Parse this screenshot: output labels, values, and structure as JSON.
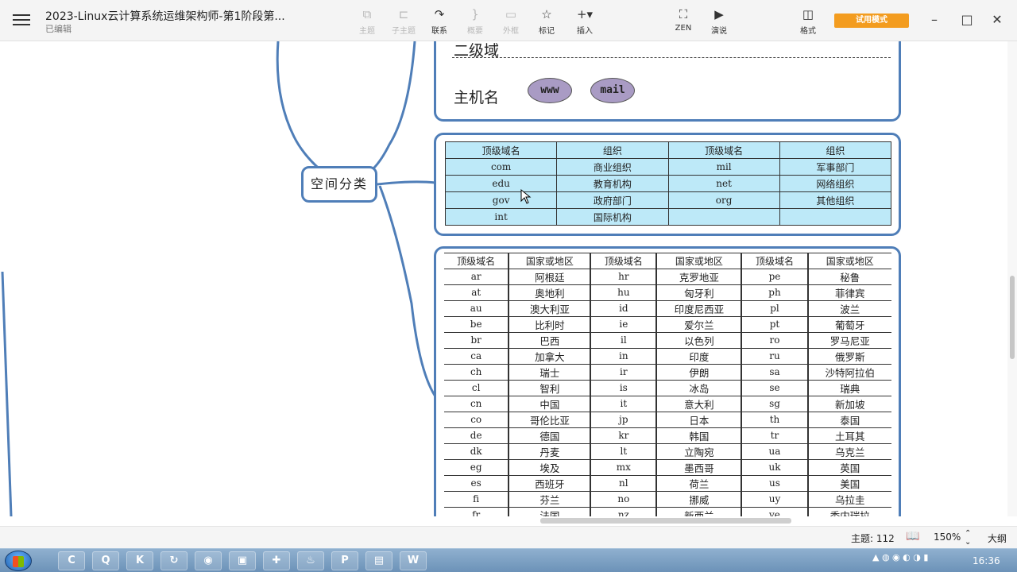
{
  "window": {
    "title": "2023-Linux云计算系统运维架构师-第1阶段第...",
    "subtitle": "已编辑"
  },
  "toolbar": {
    "tools": [
      {
        "label": "主题",
        "icon": "⧉",
        "icon_name": "topic-icon",
        "enabled": false
      },
      {
        "label": "子主题",
        "icon": "⊏",
        "icon_name": "subtopic-icon",
        "enabled": false
      },
      {
        "label": "联系",
        "icon": "↷",
        "icon_name": "relationship-icon",
        "enabled": true
      },
      {
        "label": "概要",
        "icon": "}",
        "icon_name": "summary-icon",
        "enabled": false
      },
      {
        "label": "外框",
        "icon": "▭",
        "icon_name": "boundary-icon",
        "enabled": false
      },
      {
        "label": "标记",
        "icon": "☆",
        "icon_name": "marker-icon",
        "enabled": true
      },
      {
        "label": "插入",
        "icon": "+▾",
        "icon_name": "insert-icon",
        "enabled": true
      },
      {
        "label": "ZEN",
        "icon": "⛶",
        "icon_name": "zen-icon",
        "enabled": true
      },
      {
        "label": "演说",
        "icon": "▶",
        "icon_name": "pitch-icon",
        "enabled": true
      },
      {
        "label": "格式",
        "icon": "◫",
        "icon_name": "format-icon",
        "enabled": true
      }
    ],
    "trial_label": "试用模式",
    "window_controls": {
      "minimize": "–",
      "maximize": "□",
      "close": "✕"
    }
  },
  "mindmap": {
    "level2_label": "二级域",
    "host_label": "主机名",
    "hosts": [
      "www",
      "mail"
    ],
    "center_node": "空间分类",
    "org_table": {
      "headers": [
        "顶级域名",
        "组织",
        "顶级域名",
        "组织"
      ],
      "rows": [
        [
          "com",
          "商业组织",
          "mil",
          "军事部门"
        ],
        [
          "edu",
          "教育机构",
          "net",
          "网络组织"
        ],
        [
          "gov",
          "政府部门",
          "org",
          "其他组织"
        ],
        [
          "int",
          "国际机构",
          "",
          ""
        ]
      ]
    },
    "country_table": {
      "headers": [
        "顶级域名",
        "国家或地区",
        "顶级域名",
        "国家或地区",
        "顶级域名",
        "国家或地区"
      ],
      "rows": [
        [
          "ar",
          "阿根廷",
          "hr",
          "克罗地亚",
          "pe",
          "秘鲁"
        ],
        [
          "at",
          "奥地利",
          "hu",
          "匈牙利",
          "ph",
          "菲律宾"
        ],
        [
          "au",
          "澳大利亚",
          "id",
          "印度尼西亚",
          "pl",
          "波兰"
        ],
        [
          "be",
          "比利时",
          "ie",
          "爱尔兰",
          "pt",
          "葡萄牙"
        ],
        [
          "br",
          "巴西",
          "il",
          "以色列",
          "ro",
          "罗马尼亚"
        ],
        [
          "ca",
          "加拿大",
          "in",
          "印度",
          "ru",
          "俄罗斯"
        ],
        [
          "ch",
          "瑞士",
          "ir",
          "伊朗",
          "sa",
          "沙特阿拉伯"
        ],
        [
          "cl",
          "智利",
          "is",
          "冰岛",
          "se",
          "瑞典"
        ],
        [
          "cn",
          "中国",
          "it",
          "意大利",
          "sg",
          "新加坡"
        ],
        [
          "co",
          "哥伦比亚",
          "jp",
          "日本",
          "th",
          "泰国"
        ],
        [
          "de",
          "德国",
          "kr",
          "韩国",
          "tr",
          "土耳其"
        ],
        [
          "dk",
          "丹麦",
          "lt",
          "立陶宛",
          "ua",
          "乌克兰"
        ],
        [
          "eg",
          "埃及",
          "mx",
          "墨西哥",
          "uk",
          "英国"
        ],
        [
          "es",
          "西班牙",
          "nl",
          "荷兰",
          "us",
          "美国"
        ],
        [
          "fi",
          "芬兰",
          "no",
          "挪威",
          "uy",
          "乌拉圭"
        ],
        [
          "fr",
          "法国",
          "nz",
          "新西兰",
          "ve",
          "委内瑞拉"
        ]
      ]
    }
  },
  "status": {
    "topic_count": "主题: 112",
    "zoom": "150%",
    "outline_label": "大纲"
  },
  "taskbar": {
    "apps": [
      "C",
      "Q",
      "K",
      "↻",
      "◉",
      "▣",
      "✚",
      "♨",
      "P",
      "▤",
      "W"
    ],
    "clock": "16:36"
  },
  "colors": {
    "accent": "#4f7eb8",
    "table_fill": "#bde9f8",
    "trial": "#f39c1f",
    "host_fill": "#a99bc4"
  }
}
